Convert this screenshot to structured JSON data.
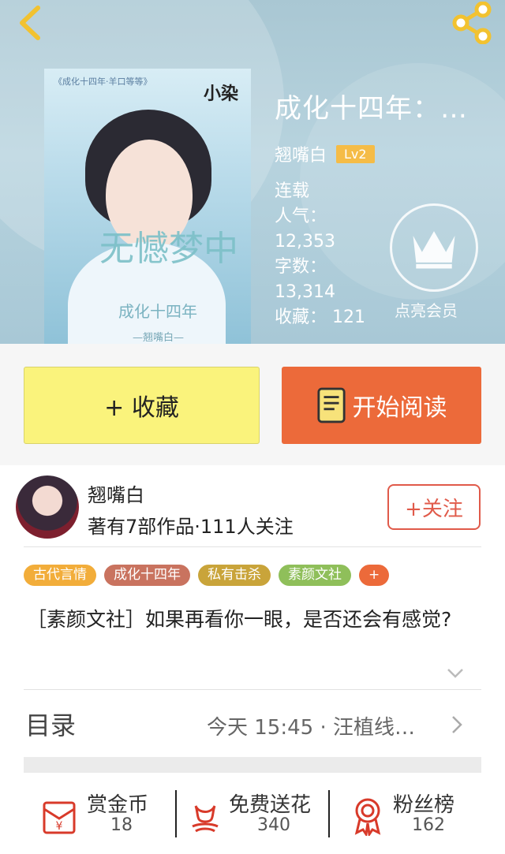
{
  "book": {
    "title": "成化十四年：…",
    "author": "翘嘴白",
    "level": "Lv2",
    "status": "连载",
    "popularity_label": "人气：",
    "popularity_value": "12,353",
    "words_label": "字数：",
    "words_value": "13,314",
    "favorites_label": "收藏：",
    "favorites_value": "121",
    "cover": {
      "top_caption": "《成化十四年·羊口等等》",
      "corner_text": "小染",
      "title_art": "无憾梦中",
      "subtitle_art": "成化十四年",
      "author_art": "—翘嘴白—"
    }
  },
  "vip": {
    "label": "点亮会员"
  },
  "actions": {
    "favorite_label": "+ 收藏",
    "read_label": "开始阅读"
  },
  "author_card": {
    "name": "翘嘴白",
    "stats": "著有7部作品·111人关注",
    "follow_label": "+关注"
  },
  "tags": [
    {
      "label": "古代言情",
      "color": "#f2ad3a"
    },
    {
      "label": "成化十四年",
      "color": "#c9735f"
    },
    {
      "label": "私有击杀",
      "color": "#c9a43a"
    },
    {
      "label": "素颜文社",
      "color": "#8fbf5a"
    },
    {
      "label": "+",
      "color": "#ec6a3a"
    }
  ],
  "description": "［素颜文社］如果再看你一眼，是否还会有感觉?",
  "toc": {
    "label": "目录",
    "latest": "今天 15:45 · 汪植线…"
  },
  "stats": [
    {
      "label": "赏金币",
      "value": "18",
      "icon": "red-envelope-icon"
    },
    {
      "label": "免费送花",
      "value": "340",
      "icon": "flower-icon"
    },
    {
      "label": "粉丝榜",
      "value": "162",
      "icon": "medal-icon"
    }
  ],
  "colors": {
    "accent_orange": "#ec6a3a",
    "favorite_yellow": "#faf37c",
    "level_badge": "#f5bc47",
    "follow_red": "#e05a4a"
  }
}
